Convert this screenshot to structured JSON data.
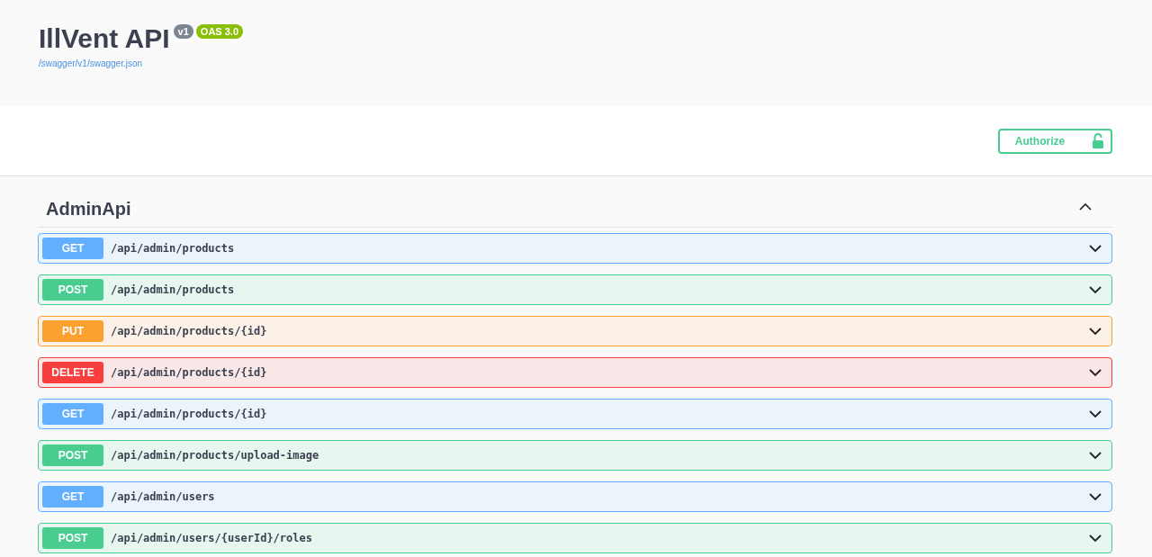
{
  "info": {
    "title": "IllVent API",
    "version": "v1",
    "oas": "OAS 3.0",
    "spec_link": "/swagger/v1/swagger.json"
  },
  "authorize": {
    "label": "Authorize",
    "locked": false
  },
  "section": {
    "name": "AdminApi",
    "expanded": true,
    "operations": [
      {
        "method": "GET",
        "path": "/api/admin/products",
        "expanded": false
      },
      {
        "method": "POST",
        "path": "/api/admin/products",
        "expanded": false
      },
      {
        "method": "PUT",
        "path": "/api/admin/products/{id}",
        "expanded": false
      },
      {
        "method": "DELETE",
        "path": "/api/admin/products/{id}",
        "expanded": false
      },
      {
        "method": "GET",
        "path": "/api/admin/products/{id}",
        "expanded": false
      },
      {
        "method": "POST",
        "path": "/api/admin/products/upload-image",
        "expanded": false
      },
      {
        "method": "GET",
        "path": "/api/admin/users",
        "expanded": false
      },
      {
        "method": "POST",
        "path": "/api/admin/users/{userId}/roles",
        "expanded": false
      }
    ]
  }
}
